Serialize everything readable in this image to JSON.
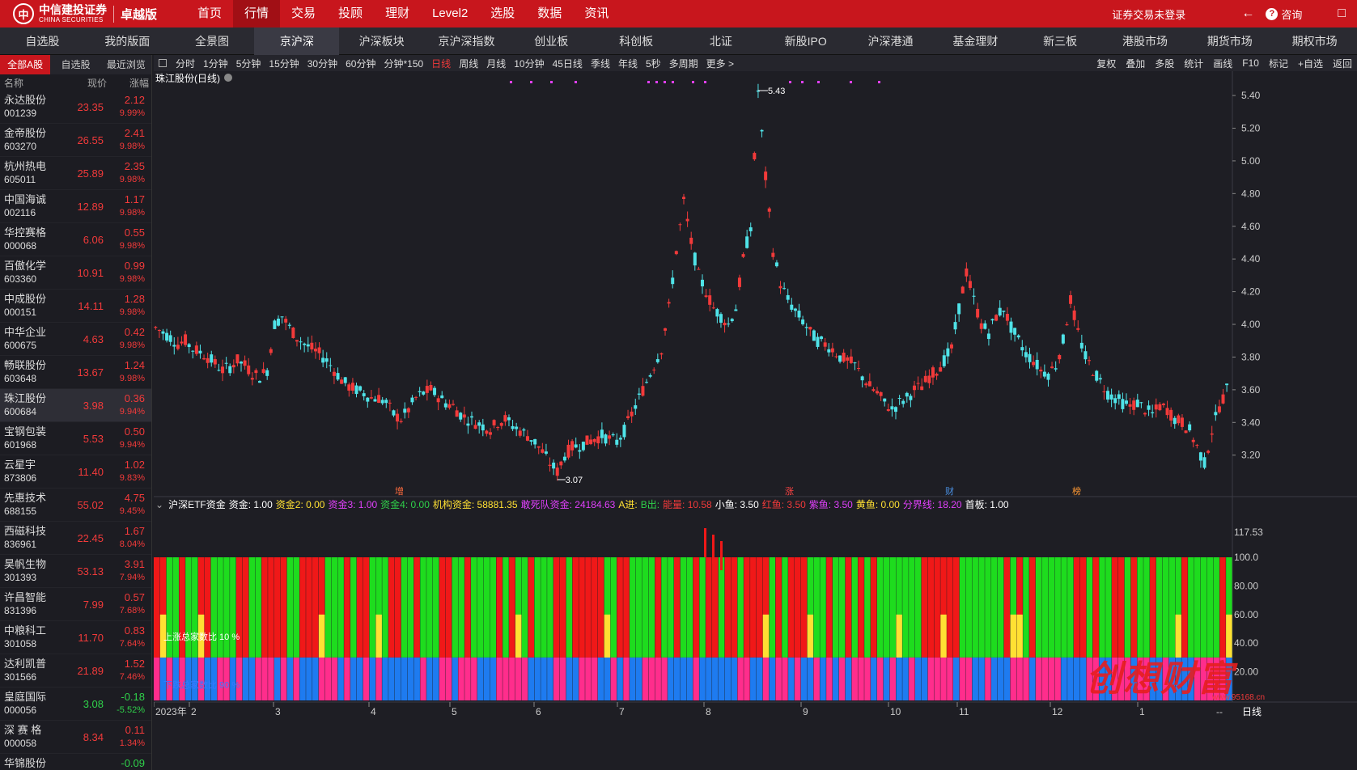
{
  "brand": {
    "name_cn": "中信建投证券",
    "name_en": "CHINA SECURITIES",
    "edition": "卓越版",
    "logo_mark": "中"
  },
  "top_nav": [
    "首页",
    "行情",
    "交易",
    "投顾",
    "理财",
    "Level2",
    "选股",
    "数据",
    "资讯"
  ],
  "top_nav_active": 1,
  "top_right": {
    "login_status": "证券交易未登录",
    "back_icon": "←",
    "consult_label": "咨询",
    "consult_icon": "?",
    "fullscreen_icon": "□"
  },
  "market_tabs": [
    "自选股",
    "我的版面",
    "全景图",
    "京沪深",
    "沪深板块",
    "京沪深指数",
    "创业板",
    "科创板",
    "北证",
    "新股IPO",
    "沪深港通",
    "基金理财",
    "新三板",
    "港股市场",
    "期货市场",
    "期权市场"
  ],
  "market_tab_active": 3,
  "list_tabs": [
    "全部A股",
    "自选股",
    "最近浏览"
  ],
  "list_headers": {
    "name": "名称",
    "price": "现价",
    "change": "涨幅"
  },
  "stocks": [
    {
      "name": "永达股份",
      "code": "001239",
      "price": "23.35",
      "chg": "2.12",
      "pct": "9.99%",
      "dir": "up"
    },
    {
      "name": "金帝股份",
      "code": "603270",
      "price": "26.55",
      "chg": "2.41",
      "pct": "9.98%",
      "dir": "up"
    },
    {
      "name": "杭州热电",
      "code": "605011",
      "price": "25.89",
      "chg": "2.35",
      "pct": "9.98%",
      "dir": "up"
    },
    {
      "name": "中国海诚",
      "code": "002116",
      "price": "12.89",
      "chg": "1.17",
      "pct": "9.98%",
      "dir": "up"
    },
    {
      "name": "华控赛格",
      "code": "000068",
      "price": "6.06",
      "chg": "0.55",
      "pct": "9.98%",
      "dir": "up"
    },
    {
      "name": "百傲化学",
      "code": "603360",
      "price": "10.91",
      "chg": "0.99",
      "pct": "9.98%",
      "dir": "up"
    },
    {
      "name": "中成股份",
      "code": "000151",
      "price": "14.11",
      "chg": "1.28",
      "pct": "9.98%",
      "dir": "up"
    },
    {
      "name": "中华企业",
      "code": "600675",
      "price": "4.63",
      "chg": "0.42",
      "pct": "9.98%",
      "dir": "up"
    },
    {
      "name": "畅联股份",
      "code": "603648",
      "price": "13.67",
      "chg": "1.24",
      "pct": "9.98%",
      "dir": "up"
    },
    {
      "name": "珠江股份",
      "code": "600684",
      "price": "3.98",
      "chg": "0.36",
      "pct": "9.94%",
      "dir": "up",
      "selected": true
    },
    {
      "name": "宝钢包装",
      "code": "601968",
      "price": "5.53",
      "chg": "0.50",
      "pct": "9.94%",
      "dir": "up"
    },
    {
      "name": "云星宇",
      "code": "873806",
      "price": "11.40",
      "chg": "1.02",
      "pct": "9.83%",
      "dir": "up"
    },
    {
      "name": "先惠技术",
      "code": "688155",
      "price": "55.02",
      "chg": "4.75",
      "pct": "9.45%",
      "dir": "up"
    },
    {
      "name": "西磁科技",
      "code": "836961",
      "price": "22.45",
      "chg": "1.67",
      "pct": "8.04%",
      "dir": "up"
    },
    {
      "name": "昊帆生物",
      "code": "301393",
      "price": "53.13",
      "chg": "3.91",
      "pct": "7.94%",
      "dir": "up"
    },
    {
      "name": "许昌智能",
      "code": "831396",
      "price": "7.99",
      "chg": "0.57",
      "pct": "7.68%",
      "dir": "up"
    },
    {
      "name": "中粮科工",
      "code": "301058",
      "price": "11.70",
      "chg": "0.83",
      "pct": "7.64%",
      "dir": "up"
    },
    {
      "name": "达利凯普",
      "code": "301566",
      "price": "21.89",
      "chg": "1.52",
      "pct": "7.46%",
      "dir": "up"
    },
    {
      "name": "皇庭国际",
      "code": "000056",
      "price": "3.08",
      "chg": "-0.18",
      "pct": "-5.52%",
      "dir": "down"
    },
    {
      "name": "深 赛 格",
      "code": "000058",
      "price": "8.34",
      "chg": "0.11",
      "pct": "1.34%",
      "dir": "up"
    },
    {
      "name": "华锦股份",
      "code": "",
      "price": "",
      "chg": "-0.09",
      "pct": "",
      "dir": "down"
    }
  ],
  "chart_periods": [
    "分时",
    "1分钟",
    "5分钟",
    "15分钟",
    "30分钟",
    "60分钟",
    "分钟*150",
    "日线",
    "周线",
    "月线",
    "10分钟",
    "45日线",
    "季线",
    "年线",
    "5秒",
    "多周期",
    "更多 >"
  ],
  "chart_period_active": 7,
  "chart_right_tools": [
    "复权",
    "叠加",
    "多股",
    "统计",
    "画线",
    "F10",
    "标记",
    "+自选",
    "返回"
  ],
  "chart_title": "珠江股份(日线)",
  "indicator": {
    "title": "沪深ETF资金",
    "items": [
      {
        "label": "资金: 1.00",
        "color": "#ffffff"
      },
      {
        "label": "资金2: 0.00",
        "color": "#ffe033"
      },
      {
        "label": "资金3: 1.00",
        "color": "#e040fb"
      },
      {
        "label": "资金4: 0.00",
        "color": "#2fd14a"
      },
      {
        "label": "机构资金: 58881.35",
        "color": "#ffe033"
      },
      {
        "label": "敢死队资金: 24184.63",
        "color": "#e040fb"
      },
      {
        "label": "A进:",
        "color": "#ffe033"
      },
      {
        "label": "B出:",
        "color": "#2fd14a"
      },
      {
        "label": "能量: 10.58",
        "color": "#f23a3a"
      },
      {
        "label": "小鱼: 3.50",
        "color": "#ffffff"
      },
      {
        "label": "红鱼: 3.50",
        "color": "#f23a3a"
      },
      {
        "label": "紫鱼: 3.50",
        "color": "#e040fb"
      },
      {
        "label": "黄鱼: 0.00",
        "color": "#ffe033"
      },
      {
        "label": "分界线: 18.20",
        "color": "#e040fb"
      },
      {
        "label": "首板: 1.00",
        "color": "#ffffff"
      }
    ],
    "axis_labels": [
      "117.53",
      "100.0",
      "80.00",
      "60.00",
      "40.00",
      "20.00"
    ],
    "rise_ratio": "上涨总家数比 10 %",
    "fall_ratio": "下跌总家数比 90 %"
  },
  "price_axis": [
    "5.40",
    "5.20",
    "5.00",
    "4.80",
    "4.60",
    "4.40",
    "4.20",
    "4.00",
    "3.80",
    "3.60",
    "3.40",
    "3.20"
  ],
  "time_axis": [
    "2023年",
    "2",
    "3",
    "4",
    "5",
    "6",
    "7",
    "8",
    "9",
    "10",
    "11",
    "12",
    "1"
  ],
  "period_label": "日线",
  "axis_dash": "--",
  "annotations": {
    "high": "5.43",
    "low": "3.07"
  },
  "event_marks": [
    "增",
    "涨",
    "财",
    "榜"
  ],
  "watermark": {
    "text": "创想财富",
    "url": "www.95168.cn"
  },
  "colors": {
    "up": "#f23a3a",
    "down": "#4fe3e8",
    "bg": "#1e1e24",
    "accent": "#c8161d"
  },
  "chart_data": {
    "type": "candlestick",
    "ylim": [
      3.07,
      5.43
    ],
    "ohlc_close_path": [
      3.98,
      3.95,
      3.92,
      3.88,
      3.9,
      3.85,
      3.83,
      3.8,
      3.76,
      3.72,
      3.74,
      3.78,
      3.75,
      3.7,
      3.68,
      3.72,
      4.0,
      4.05,
      3.98,
      3.92,
      3.88,
      3.85,
      3.82,
      3.78,
      3.72,
      3.66,
      3.62,
      3.6,
      3.58,
      3.55,
      3.55,
      3.52,
      3.45,
      3.42,
      3.48,
      3.55,
      3.58,
      3.6,
      3.56,
      3.52,
      3.5,
      3.45,
      3.42,
      3.4,
      3.38,
      3.36,
      3.4,
      3.42,
      3.38,
      3.35,
      3.32,
      3.28,
      3.22,
      3.15,
      3.1,
      3.2,
      3.25,
      3.26,
      3.28,
      3.3,
      3.32,
      3.3,
      3.28,
      3.35,
      3.45,
      3.55,
      3.65,
      3.75,
      3.85,
      4.1,
      4.45,
      4.75,
      4.5,
      4.3,
      4.2,
      4.1,
      4.05,
      4.0,
      4.1,
      4.4,
      4.6,
      5.43,
      4.9,
      4.45,
      4.25,
      4.15,
      4.08,
      4.02,
      3.95,
      3.9,
      3.88,
      3.85,
      3.8,
      3.78,
      3.75,
      3.68,
      3.62,
      3.58,
      3.52,
      3.48,
      3.52,
      3.55,
      3.6,
      3.62,
      3.68,
      3.72,
      3.78,
      3.85,
      4.1,
      4.32,
      4.15,
      4.0,
      3.95,
      4.05,
      4.1,
      3.98,
      3.9,
      3.82,
      3.78,
      3.72,
      3.7,
      3.75,
      3.9,
      4.15,
      3.95,
      3.8,
      3.72,
      3.65,
      3.58,
      3.55,
      3.52,
      3.5,
      3.52,
      3.48,
      3.45,
      3.5,
      3.48,
      3.42,
      3.4,
      3.35,
      3.25,
      3.15,
      3.35,
      3.5,
      3.6
    ]
  }
}
